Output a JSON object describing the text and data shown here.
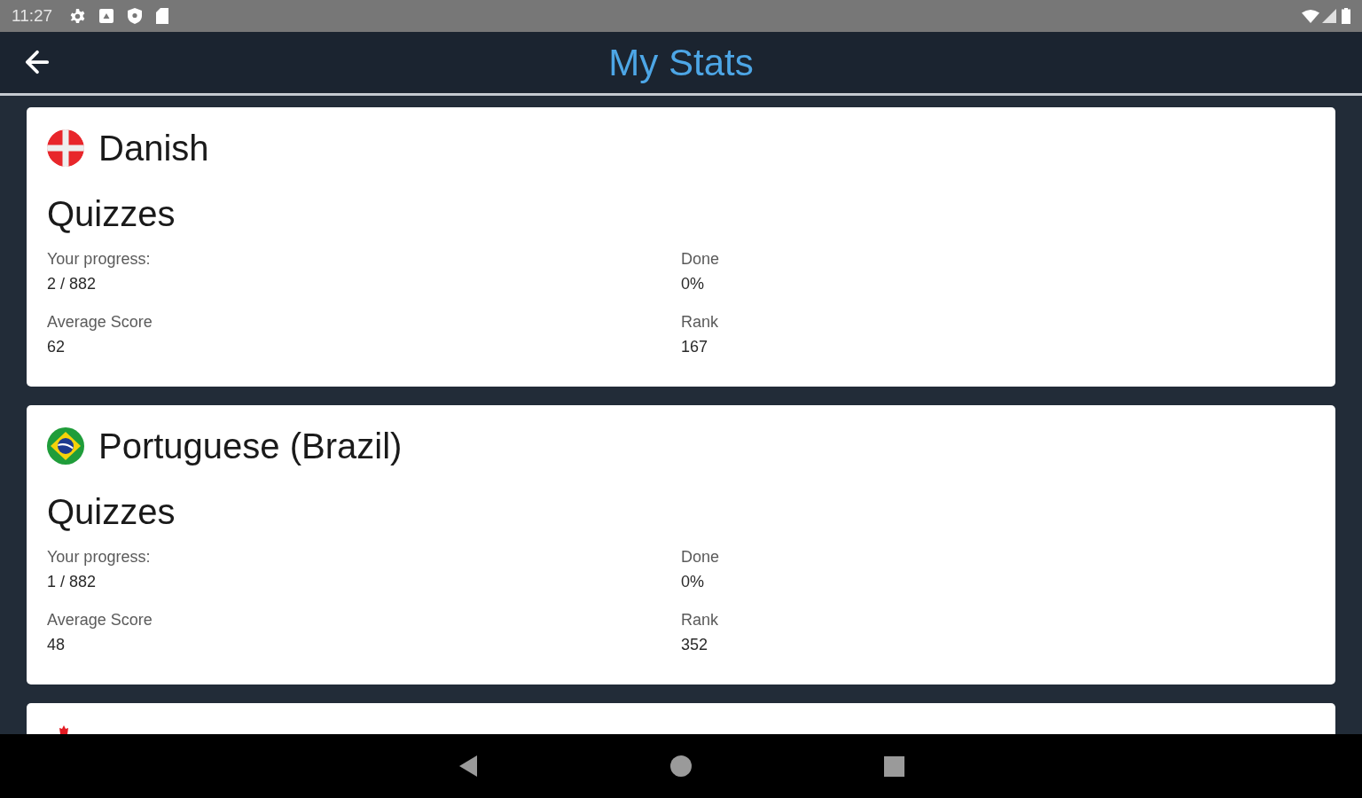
{
  "status_bar": {
    "time": "11:27"
  },
  "app_bar": {
    "title": "My Stats"
  },
  "languages": [
    {
      "kind": "denmark",
      "name": "Danish",
      "section": "Quizzes",
      "stats": [
        {
          "label": "Your progress:",
          "value": "2 / 882"
        },
        {
          "label": "Done",
          "value": "0%"
        },
        {
          "label": "Average Score",
          "value": "62"
        },
        {
          "label": "Rank",
          "value": "167"
        }
      ]
    },
    {
      "kind": "brazil",
      "name": "Portuguese (Brazil)",
      "section": "Quizzes",
      "stats": [
        {
          "label": "Your progress:",
          "value": "1 / 882"
        },
        {
          "label": "Done",
          "value": "0%"
        },
        {
          "label": "Average Score",
          "value": "48"
        },
        {
          "label": "Rank",
          "value": "352"
        }
      ]
    },
    {
      "kind": "canada"
    }
  ]
}
